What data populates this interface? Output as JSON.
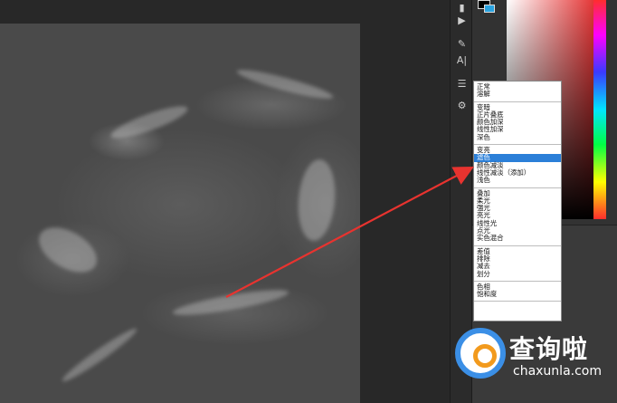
{
  "blend_menu": {
    "groups": [
      [
        "正常",
        "溶解"
      ],
      [
        "变暗",
        "正片叠底",
        "颜色加深",
        "线性加深",
        "深色"
      ],
      [
        "变亮",
        "滤色",
        "颜色减淡",
        "线性减淡（添加）",
        "浅色"
      ],
      [
        "叠加",
        "柔光",
        "强光",
        "亮光",
        "线性光",
        "点光",
        "实色混合"
      ],
      [
        "差值",
        "排除",
        "减去",
        "划分"
      ],
      [
        "色相",
        "饱和度"
      ]
    ],
    "selected": "滤色"
  },
  "watermark": {
    "text": "查询啦",
    "sub": "chaxunla.com"
  },
  "colors": {
    "arrow": "#e8332f",
    "menu_highlight": "#2b7fd8",
    "bg_swatch": "#2aa3e0",
    "fg_swatch": "#000000"
  },
  "tools": [
    "move-icon",
    "play-icon",
    "brush-icon",
    "type-icon",
    "adjust-icon",
    "settings-icon"
  ]
}
